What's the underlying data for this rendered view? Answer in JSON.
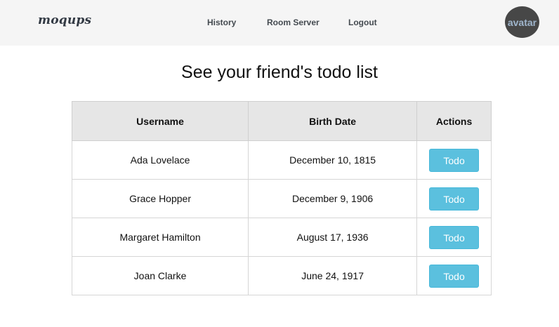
{
  "nav": {
    "logo": "moqups",
    "links": [
      "History",
      "Room Server",
      "Logout"
    ],
    "avatar_label": "avatar"
  },
  "main": {
    "title": "See your friend's todo list",
    "table": {
      "headers": [
        "Username",
        "Birth Date",
        "Actions"
      ],
      "rows": [
        {
          "username": "Ada Lovelace",
          "birth_date": "December 10, 1815",
          "action": "Todo"
        },
        {
          "username": "Grace Hopper",
          "birth_date": "December 9, 1906",
          "action": "Todo"
        },
        {
          "username": "Margaret Hamilton",
          "birth_date": "August 17, 1936",
          "action": "Todo"
        },
        {
          "username": "Joan Clarke",
          "birth_date": "June 24, 1917",
          "action": "Todo"
        }
      ]
    }
  },
  "colors": {
    "navbar_bg": "#f5f5f5",
    "header_bg": "#e6e6e6",
    "button_bg": "#5bc0de",
    "avatar_bg": "#474747"
  }
}
